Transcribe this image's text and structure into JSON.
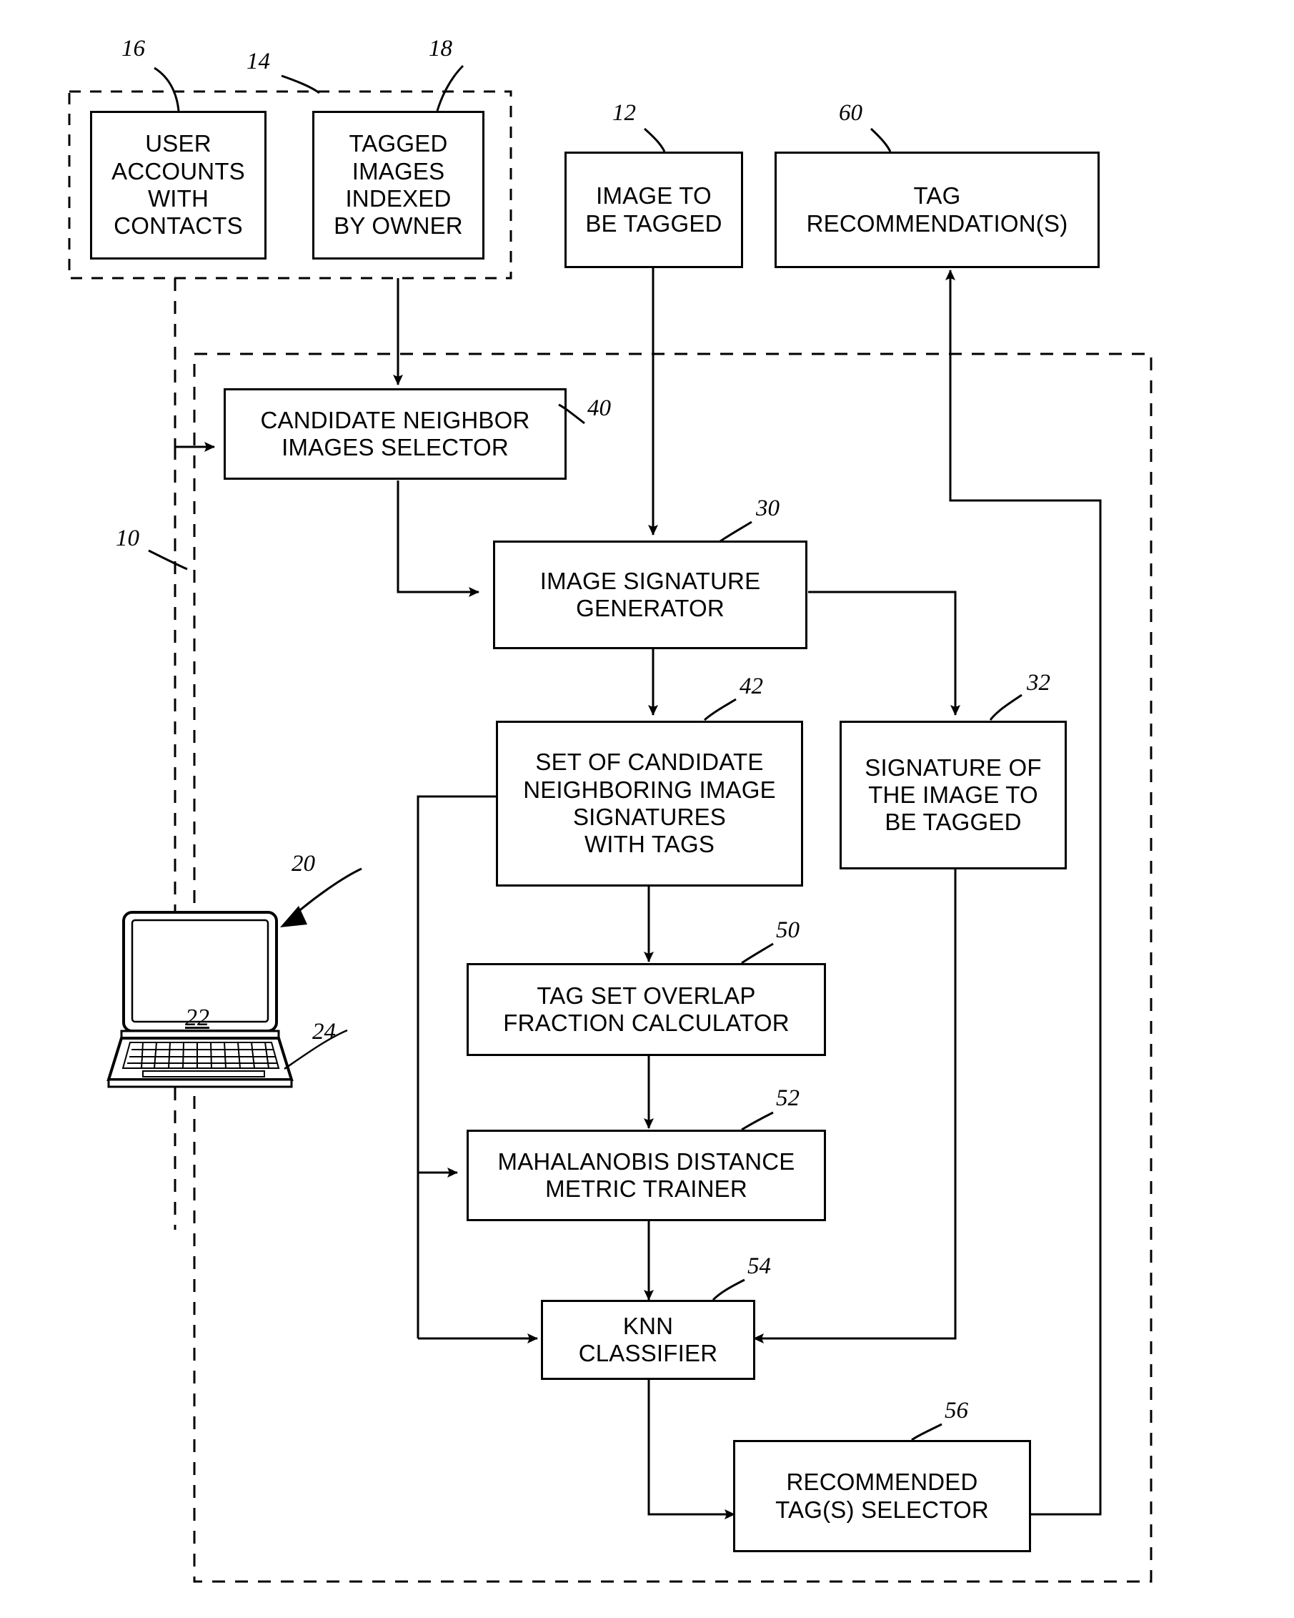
{
  "figure": {
    "title": "Image tag recommendation system block diagram",
    "system_ref": "10"
  },
  "nodes": [
    {
      "id": "user_accounts",
      "ref": "16",
      "label": "USER ACCOUNTS WITH CONTACTS"
    },
    {
      "id": "tagged_images",
      "ref": "18",
      "label": "TAGGED IMAGES INDEXED BY OWNER"
    },
    {
      "id": "storage_group",
      "ref": "14",
      "label": ""
    },
    {
      "id": "image_to_be_tagged",
      "ref": "12",
      "label": "IMAGE TO BE TAGGED"
    },
    {
      "id": "tag_recommendations",
      "ref": "60",
      "label": "TAG RECOMMENDATION(S)"
    },
    {
      "id": "candidate_selector",
      "ref": "40",
      "label": "CANDIDATE NEIGHBOR IMAGES SELECTOR"
    },
    {
      "id": "signature_generator",
      "ref": "30",
      "label": "IMAGE SIGNATURE GENERATOR"
    },
    {
      "id": "candidate_signatures",
      "ref": "42",
      "label": "SET OF CANDIDATE NEIGHBORING IMAGE SIGNATURES WITH TAGS"
    },
    {
      "id": "signature_of_image",
      "ref": "32",
      "label": "SIGNATURE OF THE IMAGE TO BE TAGGED"
    },
    {
      "id": "overlap_calculator",
      "ref": "50",
      "label": "TAG SET OVERLAP FRACTION CALCULATOR"
    },
    {
      "id": "mahalanobis_trainer",
      "ref": "52",
      "label": "MAHALANOBIS DISTANCE METRIC TRAINER"
    },
    {
      "id": "knn_classifier",
      "ref": "54",
      "label": "KNN CLASSIFIER"
    },
    {
      "id": "tag_selector",
      "ref": "56",
      "label": "RECOMMENDED TAG(S) SELECTOR"
    },
    {
      "id": "computer",
      "ref": "20",
      "label": ""
    },
    {
      "id": "display",
      "ref": "22",
      "label": "22"
    },
    {
      "id": "keyboard",
      "ref": "24",
      "label": ""
    }
  ],
  "box_text": {
    "user_accounts": [
      "USER",
      "ACCOUNTS",
      "WITH",
      "CONTACTS"
    ],
    "tagged_images": [
      "TAGGED",
      "IMAGES",
      "INDEXED",
      "BY OWNER"
    ],
    "image_to_be_tagged": [
      "IMAGE TO",
      "BE TAGGED"
    ],
    "tag_recommendations": [
      "TAG",
      "RECOMMENDATION(S)"
    ],
    "candidate_selector": [
      "CANDIDATE NEIGHBOR",
      "IMAGES SELECTOR"
    ],
    "signature_generator": [
      "IMAGE SIGNATURE",
      "GENERATOR"
    ],
    "candidate_signatures": [
      "SET OF CANDIDATE",
      "NEIGHBORING IMAGE",
      "SIGNATURES",
      "WITH TAGS"
    ],
    "signature_of_image": [
      "SIGNATURE OF",
      "THE IMAGE TO",
      "BE TAGGED"
    ],
    "overlap_calculator": [
      "TAG SET OVERLAP",
      "FRACTION CALCULATOR"
    ],
    "mahalanobis_trainer": [
      "MAHALANOBIS DISTANCE",
      "METRIC TRAINER"
    ],
    "knn_classifier": [
      "KNN",
      "CLASSIFIER"
    ],
    "tag_selector": [
      "RECOMMENDED",
      "TAG(S) SELECTOR"
    ]
  },
  "reference_numerals": {
    "n10": "10",
    "n12": "12",
    "n14": "14",
    "n16": "16",
    "n18": "18",
    "n20": "20",
    "n22": "22",
    "n24": "24",
    "n30": "30",
    "n32": "32",
    "n40": "40",
    "n42": "42",
    "n50": "50",
    "n52": "52",
    "n54": "54",
    "n56": "56",
    "n60": "60"
  },
  "colors": {
    "stroke": "#000000",
    "background": "#ffffff"
  }
}
